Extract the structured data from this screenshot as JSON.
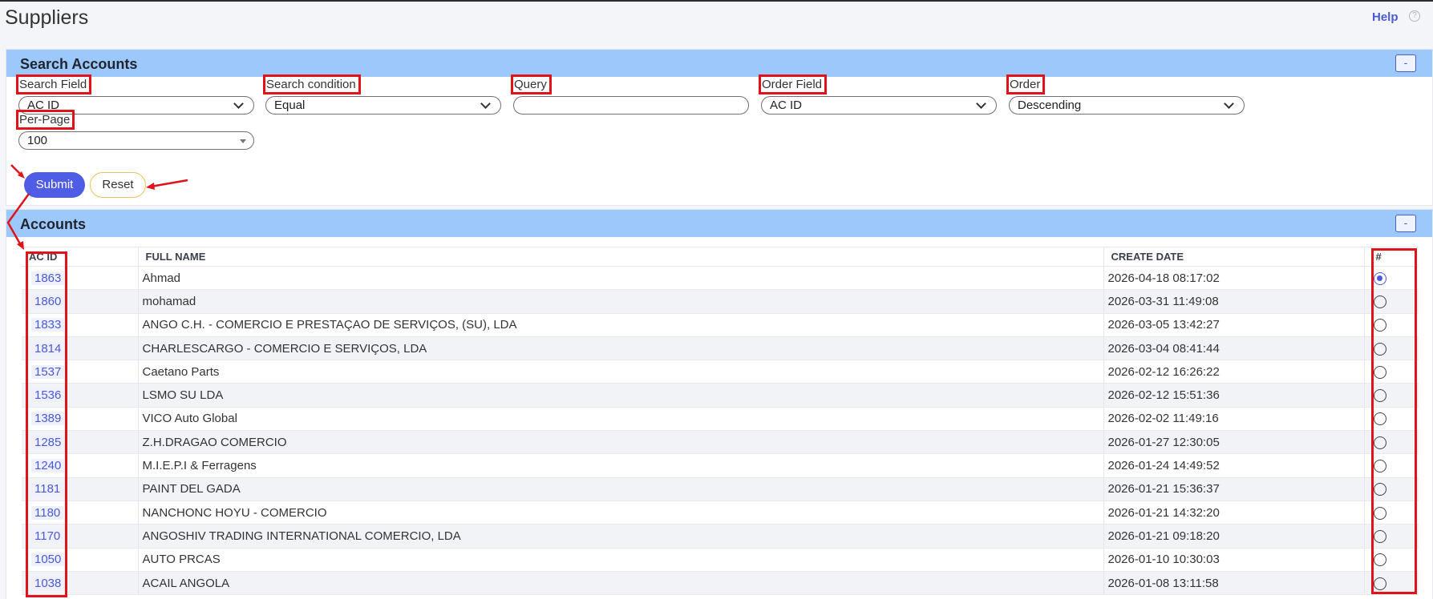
{
  "page": {
    "title": "Suppliers",
    "help_label": "Help",
    "help_icon": "help-circle-icon"
  },
  "search_panel": {
    "title": "Search Accounts",
    "collapse_label": "-",
    "fields": {
      "search_field": {
        "label": "Search Field",
        "value": "AC ID"
      },
      "search_condition": {
        "label": "Search condition",
        "value": "Equal"
      },
      "query": {
        "label": "Query",
        "value": ""
      },
      "order_field": {
        "label": "Order Field",
        "value": "AC ID"
      },
      "order": {
        "label": "Order",
        "value": "Descending"
      },
      "per_page": {
        "label": "Per-Page",
        "value": "100"
      }
    },
    "submit_label": "Submit",
    "reset_label": "Reset"
  },
  "accounts_panel": {
    "title": "Accounts",
    "collapse_label": "-",
    "columns": [
      "AC ID",
      "FULL NAME",
      "CREATE DATE",
      "#"
    ],
    "rows": [
      {
        "id": "1863",
        "name": "Ahmad",
        "date": "2026-04-18 08:17:02",
        "selected": true
      },
      {
        "id": "1860",
        "name": "mohamad",
        "date": "2026-03-31 11:49:08",
        "selected": false
      },
      {
        "id": "1833",
        "name": "ANGO C.H. - COMERCIO E PRESTAÇAO DE SERVIÇOS, (SU), LDA",
        "date": "2026-03-05 13:42:27",
        "selected": false
      },
      {
        "id": "1814",
        "name": "CHARLESCARGO - COMERCIO E SERVIÇOS, LDA",
        "date": "2026-03-04 08:41:44",
        "selected": false
      },
      {
        "id": "1537",
        "name": "Caetano Parts",
        "date": "2026-02-12 16:26:22",
        "selected": false
      },
      {
        "id": "1536",
        "name": "LSMO SU LDA",
        "date": "2026-02-12 15:51:36",
        "selected": false
      },
      {
        "id": "1389",
        "name": "VICO Auto Global",
        "date": "2026-02-02 11:49:16",
        "selected": false
      },
      {
        "id": "1285",
        "name": "Z.H.DRAGAO COMERCIO",
        "date": "2026-01-27 12:30:05",
        "selected": false
      },
      {
        "id": "1240",
        "name": "M.I.E.P.I & Ferragens",
        "date": "2026-01-24 14:49:52",
        "selected": false
      },
      {
        "id": "1181",
        "name": "PAINT DEL GADA",
        "date": "2026-01-21 15:36:37",
        "selected": false
      },
      {
        "id": "1180",
        "name": "NANCHONC HOYU - COMERCIO",
        "date": "2026-01-21 14:32:20",
        "selected": false
      },
      {
        "id": "1170",
        "name": "ANGOSHIV TRADING INTERNATIONAL COMERCIO, LDA",
        "date": "2026-01-21 09:18:20",
        "selected": false
      },
      {
        "id": "1050",
        "name": "AUTO PRCAS",
        "date": "2026-01-10 10:30:03",
        "selected": false
      },
      {
        "id": "1038",
        "name": "ACAIL ANGOLA",
        "date": "2026-01-08 13:11:58",
        "selected": false
      }
    ]
  },
  "colors": {
    "panel_header": "#9dc8fb",
    "accent": "#4f5ce6",
    "annotation": "#e0121a"
  }
}
